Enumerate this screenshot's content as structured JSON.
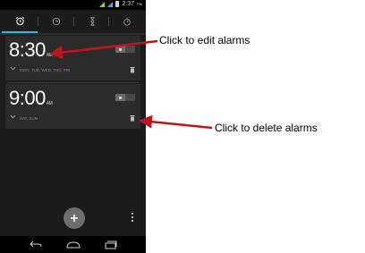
{
  "status_bar": {
    "time": "2:37",
    "time_suffix": "PM"
  },
  "tabs": [
    {
      "icon": "alarm-clock-icon",
      "active": true
    },
    {
      "icon": "clock-icon",
      "active": false
    },
    {
      "icon": "hourglass-icon",
      "active": false
    },
    {
      "icon": "stopwatch-icon",
      "active": false
    }
  ],
  "alarms": [
    {
      "time": "8:30",
      "ampm": "AM",
      "days": "MON, TUE, WED, THU, FRI"
    },
    {
      "time": "9:00",
      "ampm": "AM",
      "days": "SAT, SUN"
    }
  ],
  "annotations": {
    "edit": "Click to edit alarms",
    "delete": "Click to delete alarms"
  },
  "colors": {
    "accent": "#33b5e5",
    "arrow": "#c0141c",
    "background": "#1c1c1c"
  }
}
